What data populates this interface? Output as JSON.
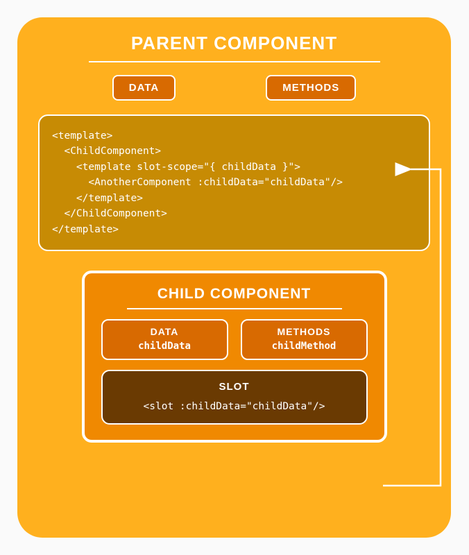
{
  "parent": {
    "title": "PARENT COMPONENT",
    "chips": {
      "data": "DATA",
      "methods": "METHODS"
    },
    "code": "<template>\n  <ChildComponent>\n    <template slot-scope=\"{ childData }\">\n      <AnotherComponent :childData=\"childData\"/>\n    </template>\n  </ChildComponent>\n</template>"
  },
  "child": {
    "title": "CHILD COMPONENT",
    "data": {
      "label": "DATA",
      "value": "childData"
    },
    "methods": {
      "label": "METHODS",
      "value": "childMethod"
    },
    "slot": {
      "label": "SLOT",
      "code": "<slot :childData=\"childData\"/>"
    }
  },
  "arrow": {
    "meaning": "child slot exposes childData to parent slot-scope"
  }
}
